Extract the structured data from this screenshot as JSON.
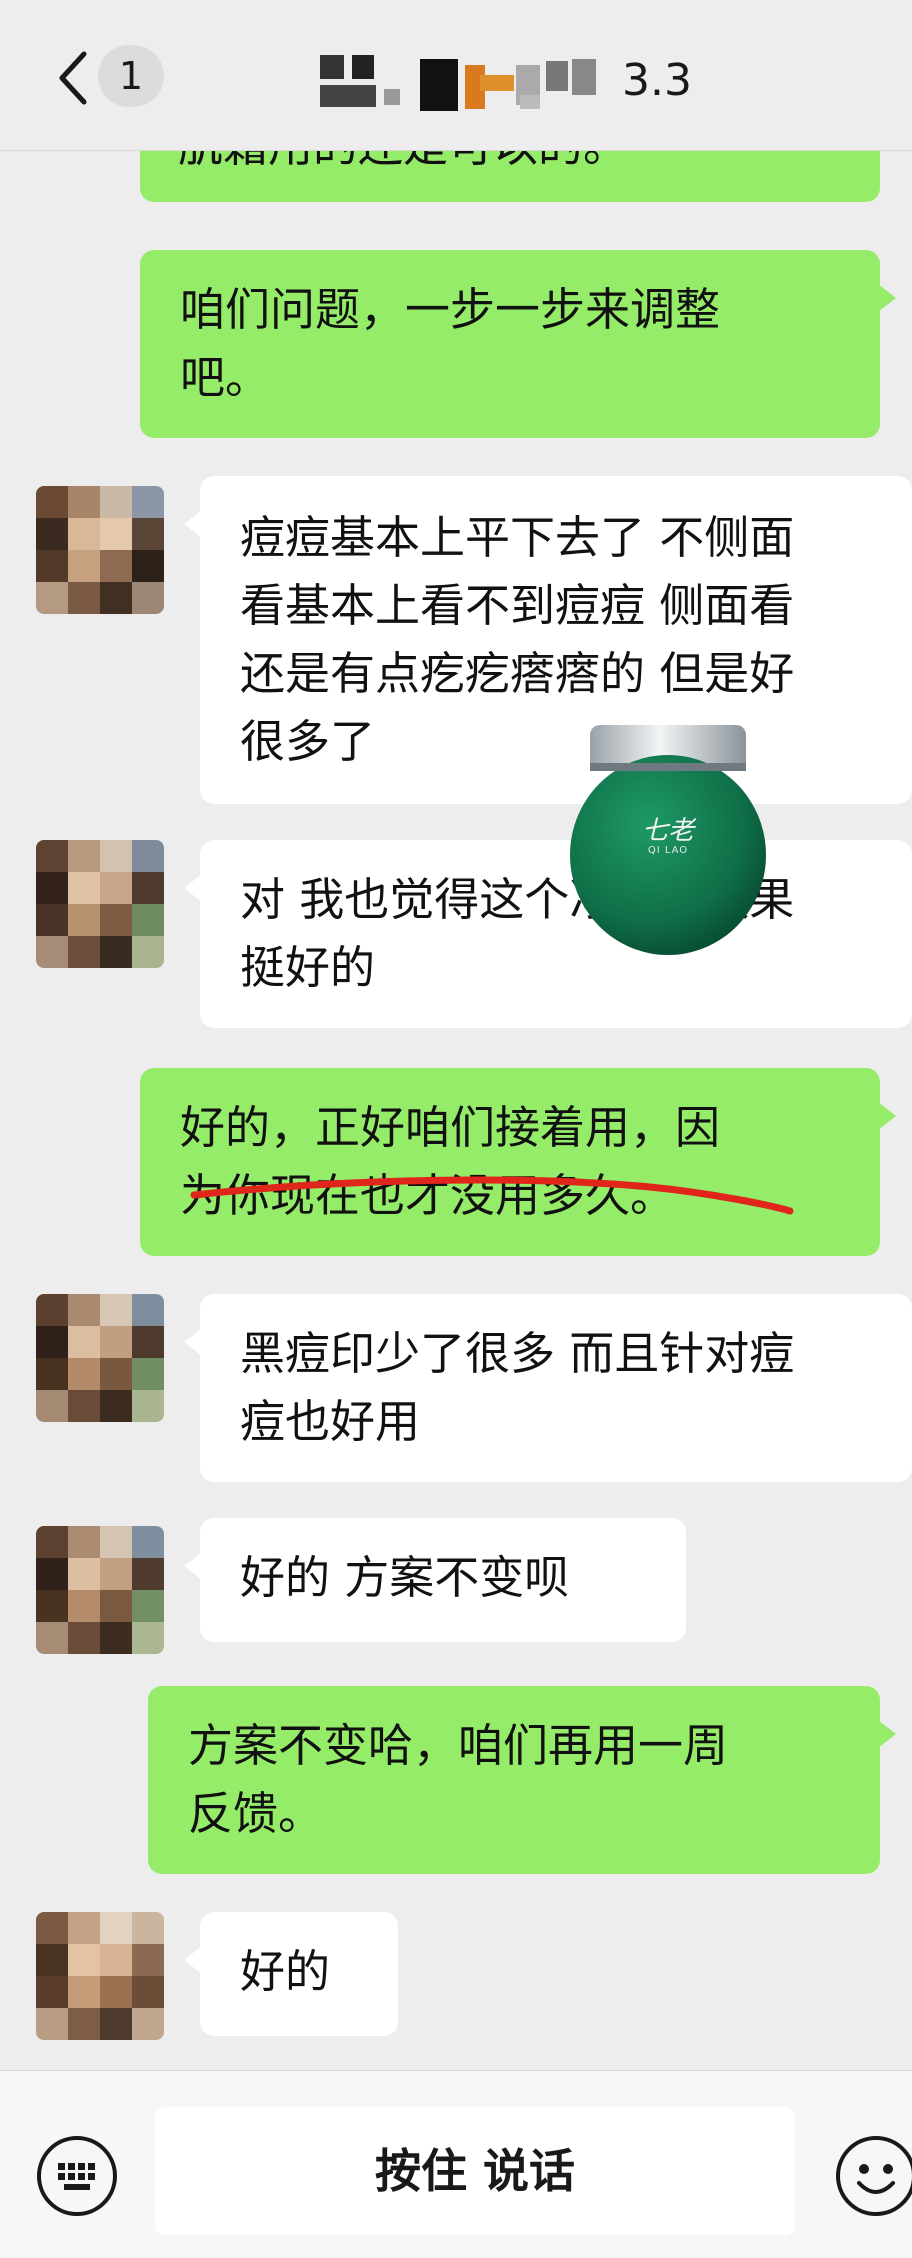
{
  "header": {
    "unread_count": "1",
    "contact_name_visible_suffix": "3.3",
    "contact_name_obscured": true
  },
  "messages": [
    {
      "id": "m0",
      "from": "me",
      "text": "肌霜用的还是可以的。"
    },
    {
      "id": "m1",
      "from": "me",
      "text": "咱们问题，一步一步来调整\n吧。"
    },
    {
      "id": "m2",
      "from": "them",
      "text": "痘痘基本上平下去了 不侧面\n看基本上看不到痘痘 侧面看\n还是有点疙疙瘩瘩的 但是好\n很多了"
    },
    {
      "id": "m3",
      "from": "them",
      "text": "对 我也觉得这个净肌霜效果\n挺好的"
    },
    {
      "id": "m4",
      "from": "me",
      "text": "好的，正好咱们接着用，因\n为你现在也才没用多久。"
    },
    {
      "id": "m5",
      "from": "them",
      "text": "黑痘印少了很多 而且针对痘\n痘也好用"
    },
    {
      "id": "m6",
      "from": "them",
      "text": "好的 方案不变呗"
    },
    {
      "id": "m7",
      "from": "me",
      "text": "方案不变哈，咱们再用一周\n反馈。"
    },
    {
      "id": "m8",
      "from": "them",
      "text": "好的"
    }
  ],
  "product_overlay": {
    "brand_text": "七老",
    "brand_latin": "QI LAO",
    "jar_color": "#0f6e47",
    "lid_color": "#d9dde0"
  },
  "annotation": {
    "type": "red underline stroke",
    "color": "#e0251b"
  },
  "input_bar": {
    "press_to_talk_label": "按住 说话",
    "left_icon": "keyboard-icon",
    "right_icon": "emoji-icon"
  },
  "colors": {
    "my_bubble": "#95ec69",
    "their_bubble": "#ffffff",
    "background": "#ededed"
  }
}
